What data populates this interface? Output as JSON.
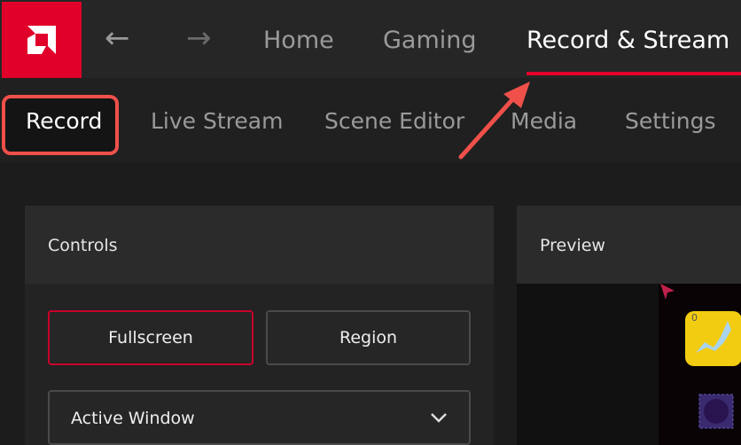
{
  "topbar": {
    "tabs": [
      {
        "label": "Home"
      },
      {
        "label": "Gaming"
      },
      {
        "label": "Record & Stream"
      }
    ],
    "accent": "#e0002a"
  },
  "subnav": {
    "items": [
      {
        "label": "Record"
      },
      {
        "label": "Live Stream"
      },
      {
        "label": "Scene Editor"
      },
      {
        "label": "Media"
      },
      {
        "label": "Settings"
      }
    ]
  },
  "controls": {
    "title": "Controls",
    "fullscreen": "Fullscreen",
    "region": "Region",
    "dropdown_value": "Active Window"
  },
  "preview": {
    "title": "Preview",
    "item_count": "0"
  }
}
